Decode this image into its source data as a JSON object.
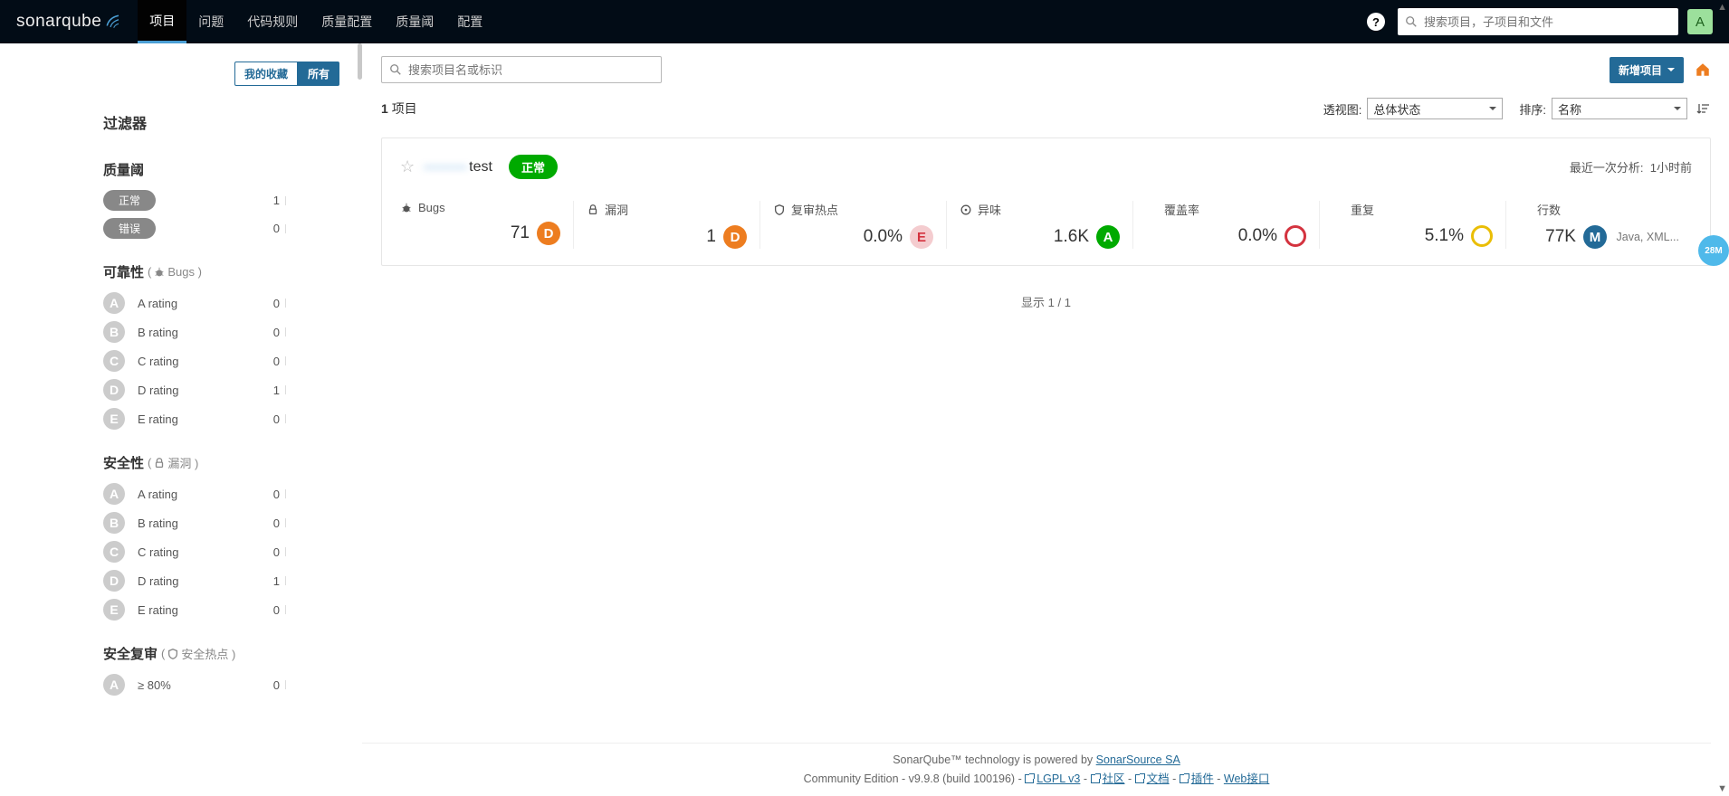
{
  "nav": {
    "logo": "sonarqube",
    "tabs": [
      "项目",
      "问题",
      "代码规则",
      "质量配置",
      "质量阈",
      "配置"
    ],
    "active_tab_index": 0,
    "search_placeholder": "搜索项目，子项目和文件",
    "avatar_letter": "A"
  },
  "sidebar": {
    "fav_tabs": {
      "mine": "我的收藏",
      "all": "所有",
      "active": "all"
    },
    "title": "过滤器",
    "sections": [
      {
        "key": "quality_gate",
        "heading": "质量阈",
        "type": "pills",
        "items": [
          {
            "label": "正常",
            "count": 1,
            "bar": 100
          },
          {
            "label": "错误",
            "count": 0,
            "bar": 0
          }
        ]
      },
      {
        "key": "reliability",
        "heading": "可靠性",
        "sub": "Bugs",
        "sub_icon": "bug",
        "type": "ratings",
        "items": [
          {
            "grade": "A",
            "label": "A rating",
            "count": 0,
            "bar": 0
          },
          {
            "grade": "B",
            "label": "B rating",
            "count": 0,
            "bar": 0
          },
          {
            "grade": "C",
            "label": "C rating",
            "count": 0,
            "bar": 0
          },
          {
            "grade": "D",
            "label": "D rating",
            "count": 1,
            "bar": 100
          },
          {
            "grade": "E",
            "label": "E rating",
            "count": 0,
            "bar": 0
          }
        ]
      },
      {
        "key": "security",
        "heading": "安全性",
        "sub": "漏洞",
        "sub_icon": "lock",
        "type": "ratings",
        "items": [
          {
            "grade": "A",
            "label": "A rating",
            "count": 0,
            "bar": 0
          },
          {
            "grade": "B",
            "label": "B rating",
            "count": 0,
            "bar": 0
          },
          {
            "grade": "C",
            "label": "C rating",
            "count": 0,
            "bar": 0
          },
          {
            "grade": "D",
            "label": "D rating",
            "count": 1,
            "bar": 100
          },
          {
            "grade": "E",
            "label": "E rating",
            "count": 0,
            "bar": 0
          }
        ]
      },
      {
        "key": "security_review",
        "heading": "安全复审",
        "sub": "安全热点",
        "sub_icon": "shield",
        "type": "ratings",
        "items": [
          {
            "grade": "A",
            "label": "≥ 80%",
            "count": 0,
            "bar": 0
          }
        ]
      }
    ]
  },
  "main": {
    "search_placeholder": "搜索项目名或标识",
    "new_project": "新增项目",
    "count_number": "1",
    "count_label": "项目",
    "perspective_label": "透视图:",
    "perspective_value": "总体状态",
    "sort_label": "排序:",
    "sort_value": "名称",
    "project": {
      "name_blur": "———",
      "name_tail": "test",
      "status": "正常",
      "last_analysis_label": "最近一次分析:",
      "last_analysis_value": "1小时前",
      "metrics": [
        {
          "icon": "bug",
          "label": "Bugs",
          "value": "71",
          "rating": "D",
          "rating_color": "#ED7D20"
        },
        {
          "icon": "lock",
          "label": "漏洞",
          "value": "1",
          "rating": "D",
          "rating_color": "#ED7D20"
        },
        {
          "icon": "shield",
          "label": "复审热点",
          "value": "0.0%",
          "rating": "E",
          "rating_color": "#D4333F",
          "rating_style": "fill-light"
        },
        {
          "icon": "smell",
          "label": "异味",
          "value": "1.6K",
          "rating": "A",
          "rating_color": "#00aa00"
        },
        {
          "icon": "coverage",
          "label": "覆盖率",
          "value": "0.0%",
          "rating_style": "outline",
          "rating_color": "#D4333F"
        },
        {
          "icon": "dupe",
          "label": "重复",
          "value": "5.1%",
          "rating_style": "outline",
          "rating_color": "#eabe06"
        },
        {
          "icon": "lines",
          "label": "行数",
          "value": "77K",
          "rating": "M",
          "rating_color": "#236a97",
          "langs": "Java, XML..."
        }
      ]
    },
    "showing": "显示 1 / 1"
  },
  "footer": {
    "line1_prefix": "SonarQube™ technology is powered by ",
    "line1_link": "SonarSource SA",
    "line2_prefix": "Community Edition - v9.9.8 (build 100196) - ",
    "links": [
      "LGPL v3",
      "社区",
      "文档",
      "插件"
    ],
    "web_api": "Web接口"
  },
  "float_pill": "28M",
  "colors": {
    "ratings": {
      "A": "#00aa00",
      "B": "#b0d513",
      "C": "#eabe06",
      "D": "#ED7D20",
      "E": "#D4333F",
      "M": "#236a97"
    }
  }
}
